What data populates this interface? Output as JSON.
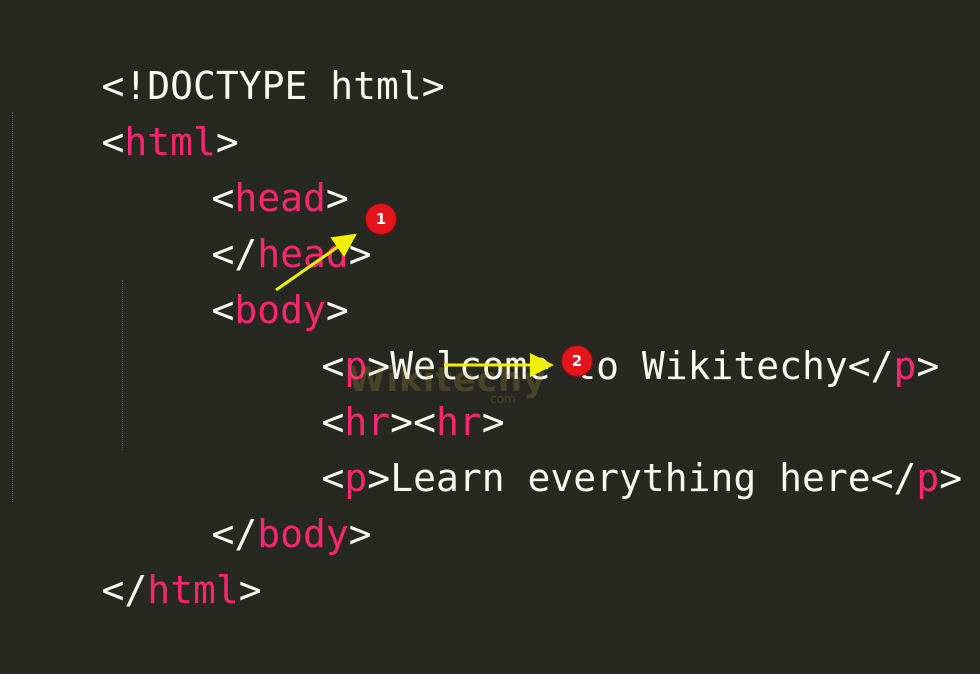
{
  "code": {
    "line1": {
      "text": "<!DOCTYPE html>"
    },
    "line2": {
      "open": "<",
      "tag": "html",
      "close": ">"
    },
    "line3": {
      "open": "<",
      "tag": "head",
      "close": ">"
    },
    "line4": {
      "open": "</",
      "tag": "head",
      "close": ">"
    },
    "line5": {
      "open": "<",
      "tag": "body",
      "close": ">"
    },
    "line6": {
      "open1": "<",
      "tag1": "p",
      "close1": ">",
      "content": "Welcome to Wikitechy",
      "open2": "</",
      "tag2": "p",
      "close2": ">"
    },
    "line7": {
      "open1": "<",
      "tag1": "hr",
      "close1": ">",
      "open2": "<",
      "tag2": "hr",
      "close2": ">"
    },
    "line8": {
      "open1": "<",
      "tag1": "p",
      "close1": ">",
      "content": "Learn everything here",
      "open2": "</",
      "tag2": "p",
      "close2": ">"
    },
    "line9": {
      "open": "</",
      "tag": "body",
      "close": ">"
    },
    "line10": {
      "open": "</",
      "tag": "html",
      "close": ">"
    }
  },
  "annotations": {
    "badge1": "1",
    "badge2": "2"
  },
  "watermark": {
    "brand": "Wikitechy",
    "sub": "com"
  },
  "colors": {
    "background": "#272822",
    "tag": "#f92672",
    "text": "#f8f8f2",
    "arrow": "#f0f000",
    "badge": "#e3141b"
  }
}
